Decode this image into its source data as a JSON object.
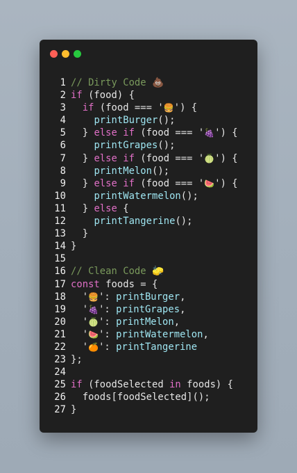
{
  "window": {
    "traffic_lights": [
      {
        "name": "close",
        "color": "#ff5f56"
      },
      {
        "name": "minimize",
        "color": "#ffbd2e"
      },
      {
        "name": "zoom",
        "color": "#27c93f"
      }
    ]
  },
  "colors": {
    "background": "#a3afbb",
    "editor_bg": "#1f1f1f",
    "keyword": "#e06fc6",
    "function": "#9fe6f2",
    "comment": "#7a9a5c",
    "string": "#f0c36a"
  },
  "code_lines": [
    {
      "n": "1",
      "indent": 0,
      "tokens": [
        [
          "c",
          "// Dirty Code 💩"
        ]
      ]
    },
    {
      "n": "2",
      "indent": 0,
      "tokens": [
        [
          "k",
          "if"
        ],
        [
          "p",
          " (food) {"
        ]
      ]
    },
    {
      "n": "3",
      "indent": 1,
      "tokens": [
        [
          "k",
          "if"
        ],
        [
          "p",
          " (food === '"
        ],
        [
          "s",
          "🍔"
        ],
        [
          "p",
          "') {"
        ]
      ]
    },
    {
      "n": "4",
      "indent": 2,
      "tokens": [
        [
          "f",
          "printBurger"
        ],
        [
          "p",
          "();"
        ]
      ]
    },
    {
      "n": "5",
      "indent": 1,
      "tokens": [
        [
          "p",
          "} "
        ],
        [
          "k",
          "else if"
        ],
        [
          "p",
          " (food === '"
        ],
        [
          "s",
          "🍇"
        ],
        [
          "p",
          "') {"
        ]
      ]
    },
    {
      "n": "6",
      "indent": 2,
      "tokens": [
        [
          "f",
          "printGrapes"
        ],
        [
          "p",
          "();"
        ]
      ]
    },
    {
      "n": "7",
      "indent": 1,
      "tokens": [
        [
          "p",
          "} "
        ],
        [
          "k",
          "else if"
        ],
        [
          "p",
          " (food === '"
        ],
        [
          "s",
          "🍈"
        ],
        [
          "p",
          "') {"
        ]
      ]
    },
    {
      "n": "8",
      "indent": 2,
      "tokens": [
        [
          "f",
          "printMelon"
        ],
        [
          "p",
          "();"
        ]
      ]
    },
    {
      "n": "9",
      "indent": 1,
      "tokens": [
        [
          "p",
          "} "
        ],
        [
          "k",
          "else if"
        ],
        [
          "p",
          " (food === '"
        ],
        [
          "s",
          "🍉"
        ],
        [
          "p",
          "') {"
        ]
      ]
    },
    {
      "n": "10",
      "indent": 2,
      "tokens": [
        [
          "f",
          "printWatermelon"
        ],
        [
          "p",
          "();"
        ]
      ]
    },
    {
      "n": "11",
      "indent": 1,
      "tokens": [
        [
          "p",
          "} "
        ],
        [
          "k",
          "else"
        ],
        [
          "p",
          " {"
        ]
      ]
    },
    {
      "n": "12",
      "indent": 2,
      "tokens": [
        [
          "f",
          "printTangerine"
        ],
        [
          "p",
          "();"
        ]
      ]
    },
    {
      "n": "13",
      "indent": 1,
      "tokens": [
        [
          "p",
          "}"
        ]
      ]
    },
    {
      "n": "14",
      "indent": 0,
      "tokens": [
        [
          "p",
          "}"
        ]
      ]
    },
    {
      "n": "15",
      "indent": 0,
      "tokens": []
    },
    {
      "n": "16",
      "indent": 0,
      "tokens": [
        [
          "c",
          "// Clean Code 🧽"
        ]
      ]
    },
    {
      "n": "17",
      "indent": 0,
      "tokens": [
        [
          "k",
          "const"
        ],
        [
          "p",
          " foods = {"
        ]
      ]
    },
    {
      "n": "18",
      "indent": 1,
      "tokens": [
        [
          "p",
          "'"
        ],
        [
          "s",
          "🍔"
        ],
        [
          "p",
          "': "
        ],
        [
          "f",
          "printBurger"
        ],
        [
          "p",
          ","
        ]
      ]
    },
    {
      "n": "19",
      "indent": 1,
      "tokens": [
        [
          "p",
          "'"
        ],
        [
          "s",
          "🍇"
        ],
        [
          "p",
          "': "
        ],
        [
          "f",
          "printGrapes"
        ],
        [
          "p",
          ","
        ]
      ]
    },
    {
      "n": "20",
      "indent": 1,
      "tokens": [
        [
          "p",
          "'"
        ],
        [
          "s",
          "🍈"
        ],
        [
          "p",
          "': "
        ],
        [
          "f",
          "printMelon"
        ],
        [
          "p",
          ","
        ]
      ]
    },
    {
      "n": "21",
      "indent": 1,
      "tokens": [
        [
          "p",
          "'"
        ],
        [
          "s",
          "🍉"
        ],
        [
          "p",
          "': "
        ],
        [
          "f",
          "printWatermelon"
        ],
        [
          "p",
          ","
        ]
      ]
    },
    {
      "n": "22",
      "indent": 1,
      "tokens": [
        [
          "p",
          "'"
        ],
        [
          "s",
          "🍊"
        ],
        [
          "p",
          "': "
        ],
        [
          "f",
          "printTangerine"
        ]
      ]
    },
    {
      "n": "23",
      "indent": 0,
      "tokens": [
        [
          "p",
          "};"
        ]
      ]
    },
    {
      "n": "24",
      "indent": 0,
      "tokens": []
    },
    {
      "n": "25",
      "indent": 0,
      "tokens": [
        [
          "k",
          "if"
        ],
        [
          "p",
          " (foodSelected "
        ],
        [
          "k",
          "in"
        ],
        [
          "p",
          " foods) {"
        ]
      ]
    },
    {
      "n": "26",
      "indent": 1,
      "tokens": [
        [
          "p",
          "foods[foodSelected]();"
        ]
      ]
    },
    {
      "n": "27",
      "indent": 0,
      "tokens": [
        [
          "p",
          "}"
        ]
      ]
    }
  ]
}
